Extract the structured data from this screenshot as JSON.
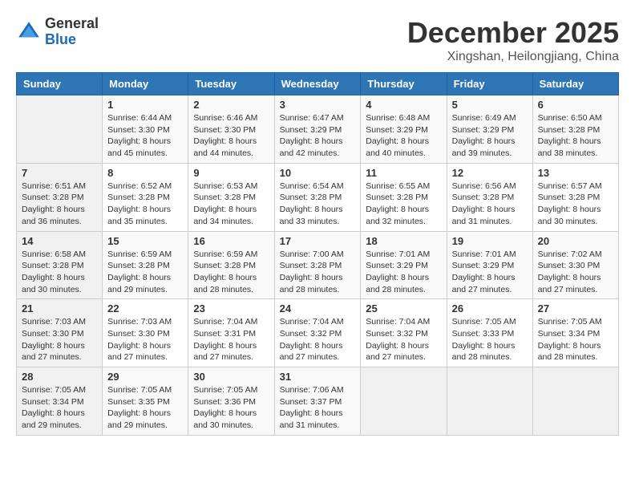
{
  "logo": {
    "general": "General",
    "blue": "Blue"
  },
  "header": {
    "month": "December 2025",
    "location": "Xingshan, Heilongjiang, China"
  },
  "weekdays": [
    "Sunday",
    "Monday",
    "Tuesday",
    "Wednesday",
    "Thursday",
    "Friday",
    "Saturday"
  ],
  "weeks": [
    [
      {
        "day": "",
        "info": ""
      },
      {
        "day": "1",
        "info": "Sunrise: 6:44 AM\nSunset: 3:30 PM\nDaylight: 8 hours\nand 45 minutes."
      },
      {
        "day": "2",
        "info": "Sunrise: 6:46 AM\nSunset: 3:30 PM\nDaylight: 8 hours\nand 44 minutes."
      },
      {
        "day": "3",
        "info": "Sunrise: 6:47 AM\nSunset: 3:29 PM\nDaylight: 8 hours\nand 42 minutes."
      },
      {
        "day": "4",
        "info": "Sunrise: 6:48 AM\nSunset: 3:29 PM\nDaylight: 8 hours\nand 40 minutes."
      },
      {
        "day": "5",
        "info": "Sunrise: 6:49 AM\nSunset: 3:29 PM\nDaylight: 8 hours\nand 39 minutes."
      },
      {
        "day": "6",
        "info": "Sunrise: 6:50 AM\nSunset: 3:28 PM\nDaylight: 8 hours\nand 38 minutes."
      }
    ],
    [
      {
        "day": "7",
        "info": "Sunrise: 6:51 AM\nSunset: 3:28 PM\nDaylight: 8 hours\nand 36 minutes."
      },
      {
        "day": "8",
        "info": "Sunrise: 6:52 AM\nSunset: 3:28 PM\nDaylight: 8 hours\nand 35 minutes."
      },
      {
        "day": "9",
        "info": "Sunrise: 6:53 AM\nSunset: 3:28 PM\nDaylight: 8 hours\nand 34 minutes."
      },
      {
        "day": "10",
        "info": "Sunrise: 6:54 AM\nSunset: 3:28 PM\nDaylight: 8 hours\nand 33 minutes."
      },
      {
        "day": "11",
        "info": "Sunrise: 6:55 AM\nSunset: 3:28 PM\nDaylight: 8 hours\nand 32 minutes."
      },
      {
        "day": "12",
        "info": "Sunrise: 6:56 AM\nSunset: 3:28 PM\nDaylight: 8 hours\nand 31 minutes."
      },
      {
        "day": "13",
        "info": "Sunrise: 6:57 AM\nSunset: 3:28 PM\nDaylight: 8 hours\nand 30 minutes."
      }
    ],
    [
      {
        "day": "14",
        "info": "Sunrise: 6:58 AM\nSunset: 3:28 PM\nDaylight: 8 hours\nand 30 minutes."
      },
      {
        "day": "15",
        "info": "Sunrise: 6:59 AM\nSunset: 3:28 PM\nDaylight: 8 hours\nand 29 minutes."
      },
      {
        "day": "16",
        "info": "Sunrise: 6:59 AM\nSunset: 3:28 PM\nDaylight: 8 hours\nand 28 minutes."
      },
      {
        "day": "17",
        "info": "Sunrise: 7:00 AM\nSunset: 3:28 PM\nDaylight: 8 hours\nand 28 minutes."
      },
      {
        "day": "18",
        "info": "Sunrise: 7:01 AM\nSunset: 3:29 PM\nDaylight: 8 hours\nand 28 minutes."
      },
      {
        "day": "19",
        "info": "Sunrise: 7:01 AM\nSunset: 3:29 PM\nDaylight: 8 hours\nand 27 minutes."
      },
      {
        "day": "20",
        "info": "Sunrise: 7:02 AM\nSunset: 3:30 PM\nDaylight: 8 hours\nand 27 minutes."
      }
    ],
    [
      {
        "day": "21",
        "info": "Sunrise: 7:03 AM\nSunset: 3:30 PM\nDaylight: 8 hours\nand 27 minutes."
      },
      {
        "day": "22",
        "info": "Sunrise: 7:03 AM\nSunset: 3:30 PM\nDaylight: 8 hours\nand 27 minutes."
      },
      {
        "day": "23",
        "info": "Sunrise: 7:04 AM\nSunset: 3:31 PM\nDaylight: 8 hours\nand 27 minutes."
      },
      {
        "day": "24",
        "info": "Sunrise: 7:04 AM\nSunset: 3:32 PM\nDaylight: 8 hours\nand 27 minutes."
      },
      {
        "day": "25",
        "info": "Sunrise: 7:04 AM\nSunset: 3:32 PM\nDaylight: 8 hours\nand 27 minutes."
      },
      {
        "day": "26",
        "info": "Sunrise: 7:05 AM\nSunset: 3:33 PM\nDaylight: 8 hours\nand 28 minutes."
      },
      {
        "day": "27",
        "info": "Sunrise: 7:05 AM\nSunset: 3:34 PM\nDaylight: 8 hours\nand 28 minutes."
      }
    ],
    [
      {
        "day": "28",
        "info": "Sunrise: 7:05 AM\nSunset: 3:34 PM\nDaylight: 8 hours\nand 29 minutes."
      },
      {
        "day": "29",
        "info": "Sunrise: 7:05 AM\nSunset: 3:35 PM\nDaylight: 8 hours\nand 29 minutes."
      },
      {
        "day": "30",
        "info": "Sunrise: 7:05 AM\nSunset: 3:36 PM\nDaylight: 8 hours\nand 30 minutes."
      },
      {
        "day": "31",
        "info": "Sunrise: 7:06 AM\nSunset: 3:37 PM\nDaylight: 8 hours\nand 31 minutes."
      },
      {
        "day": "",
        "info": ""
      },
      {
        "day": "",
        "info": ""
      },
      {
        "day": "",
        "info": ""
      }
    ]
  ]
}
